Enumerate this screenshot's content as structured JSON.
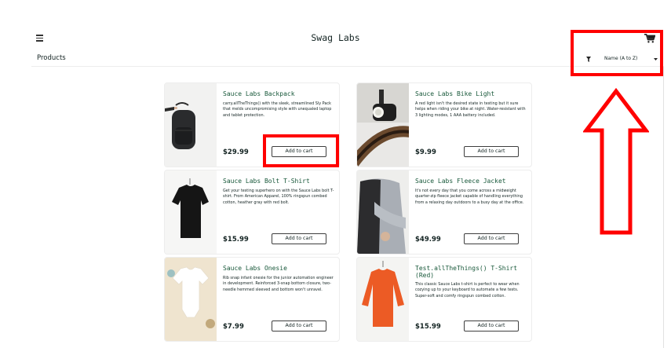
{
  "header": {
    "logo": "Swag Labs"
  },
  "subheader": {
    "title": "Products",
    "sort_label": "Name (A to Z)"
  },
  "products": [
    {
      "name": "Sauce Labs Backpack",
      "desc": "carry.allTheThings() with the sleek, streamlined Sly Pack that melds uncompromising style with unequaled laptop and tablet protection.",
      "price": "$29.99",
      "button": "Add to cart"
    },
    {
      "name": "Sauce Labs Bike Light",
      "desc": "A red light isn't the desired state in testing but it sure helps when riding your bike at night. Water-resistant with 3 lighting modes, 1 AAA battery included.",
      "price": "$9.99",
      "button": "Add to cart"
    },
    {
      "name": "Sauce Labs Bolt T-Shirt",
      "desc": "Get your testing superhero on with the Sauce Labs bolt T-shirt. From American Apparel, 100% ringspun combed cotton, heather gray with red bolt.",
      "price": "$15.99",
      "button": "Add to cart"
    },
    {
      "name": "Sauce Labs Fleece Jacket",
      "desc": "It's not every day that you come across a midweight quarter-zip fleece jacket capable of handling everything from a relaxing day outdoors to a busy day at the office.",
      "price": "$49.99",
      "button": "Add to cart"
    },
    {
      "name": "Sauce Labs Onesie",
      "desc": "Rib snap infant onesie for the junior automation engineer in development. Reinforced 3-snap bottom closure, two-needle hemmed sleeved and bottom won't unravel.",
      "price": "$7.99",
      "button": "Add to cart"
    },
    {
      "name": "Test.allTheThings() T-Shirt (Red)",
      "desc": "This classic Sauce Labs t-shirt is perfect to wear when cozying up to your keyboard to automate a few tests. Super-soft and comfy ringspun combed cotton.",
      "price": "$15.99",
      "button": "Add to cart"
    }
  ],
  "colors": {
    "accent_red": "#ff0000",
    "product_name": "#18583a",
    "text": "#132322"
  }
}
